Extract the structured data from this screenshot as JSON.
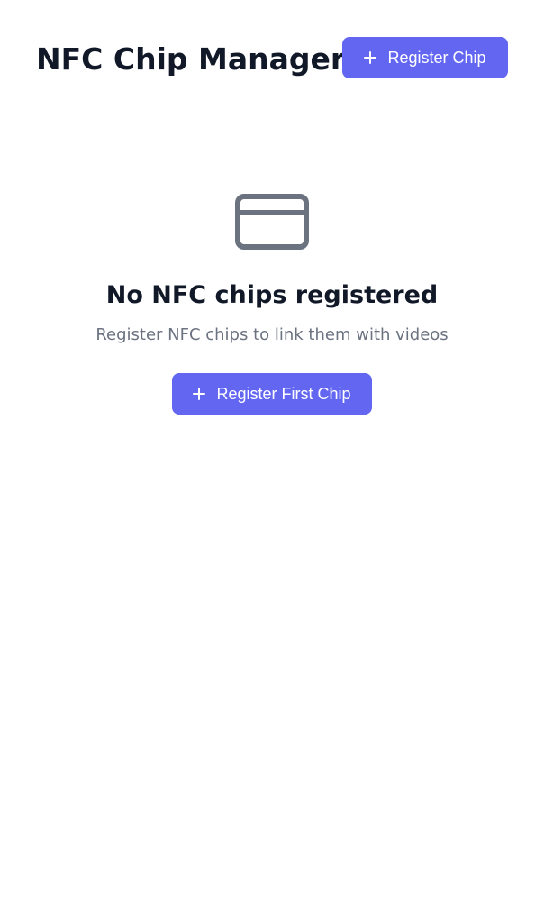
{
  "header": {
    "title": "NFC Chip Manager",
    "register_button_label": "Register Chip"
  },
  "empty_state": {
    "icon": "credit-card-icon",
    "title": "No NFC chips registered",
    "subtitle": "Register NFC chips to link them with videos",
    "button_label": "Register First Chip"
  },
  "colors": {
    "accent": "#6366f1",
    "title_text": "#111827",
    "muted_text": "#6b7280",
    "icon": "#6b7280"
  }
}
